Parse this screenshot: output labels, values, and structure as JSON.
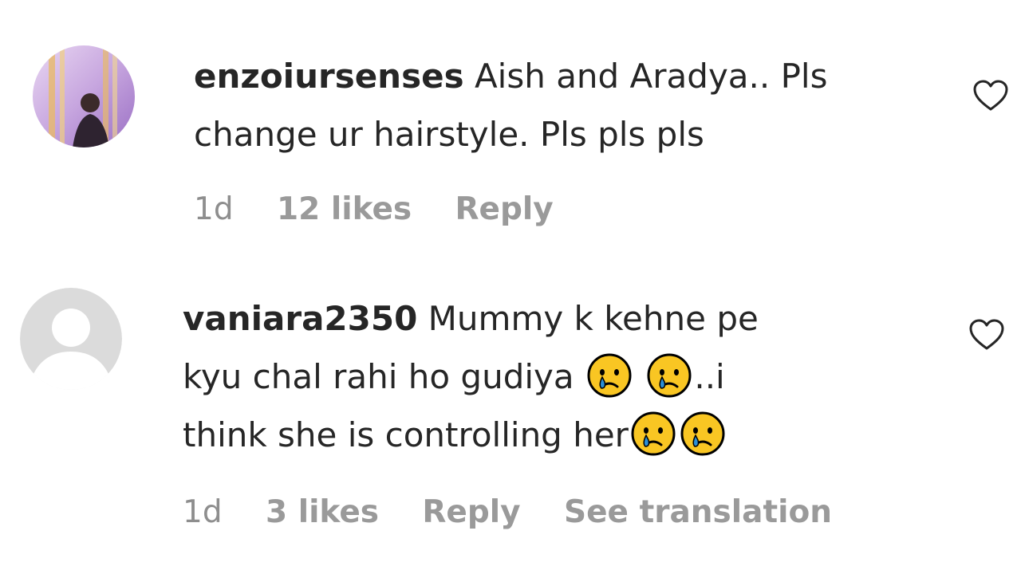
{
  "comments": [
    {
      "username": "enzoiursenses",
      "text_lines": [
        "Aish and Aradya.. Pls",
        "change ur hairstyle. Pls pls pls"
      ],
      "time": "1d",
      "likes": "12 likes",
      "reply": "Reply",
      "avatar_icon": "user-photo-avatar",
      "like_icon": "heart-outline-icon"
    },
    {
      "username": "vaniara2350",
      "text_line1": "Mummy k kehne pe",
      "text_line2": "kyu chal rahi ho gudiya",
      "text_line2_suffix": "..i",
      "text_line3": "think she is controlling her",
      "emoji_icon": "crying-face-emoji",
      "time": "1d",
      "likes": "3 likes",
      "reply": "Reply",
      "see_translation": "See translation",
      "avatar_icon": "default-avatar",
      "like_icon": "heart-outline-icon"
    }
  ],
  "colors": {
    "text": "#262626",
    "meta": "#8e8e8e",
    "default_avatar_bg": "#dbdbdb"
  }
}
